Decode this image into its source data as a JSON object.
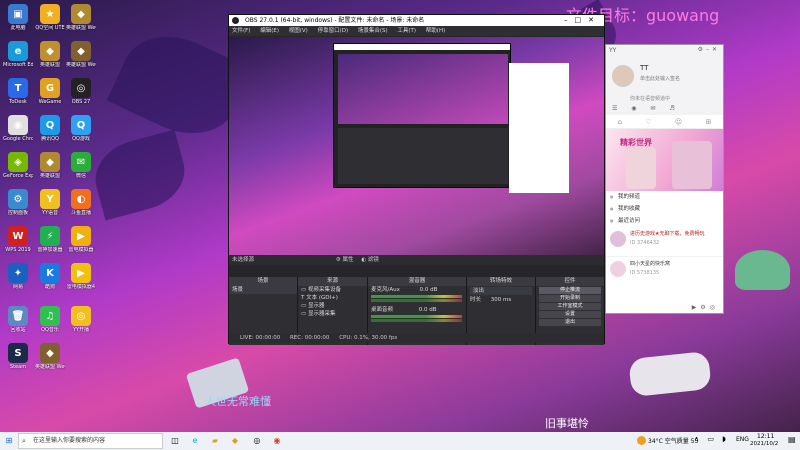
{
  "desktop": {
    "icons": [
      {
        "label": "此电脑",
        "glyph": "▣",
        "color": "#3a7ad0"
      },
      {
        "label": "QQ空间\nUTE",
        "glyph": "★",
        "color": "#f0b020"
      },
      {
        "label": "英雄联盟\nWeGame版",
        "glyph": "◆",
        "color": "#b08a30"
      },
      {
        "label": "Microsoft\nEdge",
        "glyph": "e",
        "color": "#1a9ad8"
      },
      {
        "label": "英雄联盟",
        "glyph": "◆",
        "color": "#c09030"
      },
      {
        "label": "英雄联盟\nWeGame版",
        "glyph": "◆",
        "color": "#806030"
      },
      {
        "label": "ToDesk",
        "glyph": "T",
        "color": "#2a6ae8"
      },
      {
        "label": "WeGame",
        "glyph": "G",
        "color": "#e0a020"
      },
      {
        "label": "OBS 27",
        "glyph": "◎",
        "color": "#222"
      },
      {
        "label": "Google\nChrome",
        "glyph": "◉",
        "color": "#e0e0e0"
      },
      {
        "label": "腾讯QQ",
        "glyph": "Q",
        "color": "#1a9ae8"
      },
      {
        "label": "QQ游戏",
        "glyph": "Q",
        "color": "#30a0f0"
      },
      {
        "label": "GeForce\nExperience",
        "glyph": "◈",
        "color": "#76b900"
      },
      {
        "label": "英雄联盟",
        "glyph": "◆",
        "color": "#b08a30"
      },
      {
        "label": "微信",
        "glyph": "✉",
        "color": "#2aae3a"
      },
      {
        "label": "控制面板",
        "glyph": "⚙",
        "color": "#3a8ad0"
      },
      {
        "label": "YY语音",
        "glyph": "Y",
        "color": "#f0c020"
      },
      {
        "label": "斗鱼直播",
        "glyph": "◐",
        "color": "#f07020"
      },
      {
        "label": "WPS 2019",
        "glyph": "W",
        "color": "#d02020"
      },
      {
        "label": "雷神加速器",
        "glyph": "⚡",
        "color": "#20b050"
      },
      {
        "label": "雷电模拟器",
        "glyph": "▶",
        "color": "#f0b010"
      },
      {
        "label": "网易",
        "glyph": "✦",
        "color": "#1a60c0"
      },
      {
        "label": "酷狗",
        "glyph": "K",
        "color": "#1a7ae0"
      },
      {
        "label": "雷电模拟器4",
        "glyph": "▶",
        "color": "#f0c010"
      },
      {
        "label": "回收站",
        "glyph": "🗑",
        "color": "#5a8ac0"
      },
      {
        "label": "QQ音乐",
        "glyph": "♫",
        "color": "#30c050"
      },
      {
        "label": "YY开播",
        "glyph": "◎",
        "color": "#f0c020"
      },
      {
        "label": "Steam",
        "glyph": "S",
        "color": "#1a2a48"
      },
      {
        "label": "英雄联盟\nWeGame版",
        "glyph": "◆",
        "color": "#806030"
      }
    ],
    "watermark": "文件目标：guowang",
    "subtitle_left": "人世无常难懂",
    "subtitle_right": "旧事堪怜"
  },
  "obs": {
    "title": "OBS 27.0.1 (64-bit, windows) - 配置文件: 未命名 - 场景: 未命名",
    "menu": [
      "文件(F)",
      "编辑(E)",
      "视图(V)",
      "停靠窗口(D)",
      "场景集合(S)",
      "工具(T)",
      "帮助(H)"
    ],
    "preview_source": "未选择源",
    "props_btn": "属性",
    "filters_btn": "滤镜",
    "scenes": {
      "header": "场景",
      "items": [
        "场景"
      ]
    },
    "sources": {
      "header": "来源",
      "items": [
        "视频采集设备",
        "文本 (GDI+)",
        "显示器",
        "显示器采集"
      ]
    },
    "mixer": {
      "header": "混音器",
      "channels": [
        {
          "name": "麦克风/Aux",
          "db": "0.0 dB"
        },
        {
          "name": "桌面音频",
          "db": "0.0 dB"
        }
      ]
    },
    "transitions": {
      "header": "转场特效",
      "type": "淡出",
      "duration_label": "时长",
      "duration": "300 ms"
    },
    "controls": {
      "header": "控件",
      "buttons": [
        "停止推流",
        "开始录制",
        "工作室模式",
        "设置",
        "退出"
      ]
    },
    "status": {
      "live": "LIVE: 00:00:00",
      "rec": "REC: 00:00:00",
      "cpu": "CPU: 0.1%, 30.00 fps"
    },
    "inner_search": "在这里输入你要搜索的内容"
  },
  "yy": {
    "brand": "YY",
    "username": "TT",
    "signature": "单击此处输入签名",
    "status": "你未在语音频道中",
    "banner_title": "精彩世界",
    "sections": [
      "我的频道",
      "我的收藏",
      "最近访问"
    ],
    "recent": [
      {
        "title": "进历史游戏★无聊下载，免费畅玩",
        "id": "ID 3746432"
      },
      {
        "title": "四小天星的快乐窝",
        "id": "ID 5738135"
      }
    ]
  },
  "taskbar": {
    "search_placeholder": "在这里输入你要搜索的内容",
    "weather": "34°C 空气质量 55",
    "lang": "ENG",
    "time": "12:11",
    "date": "2021/10/2"
  }
}
